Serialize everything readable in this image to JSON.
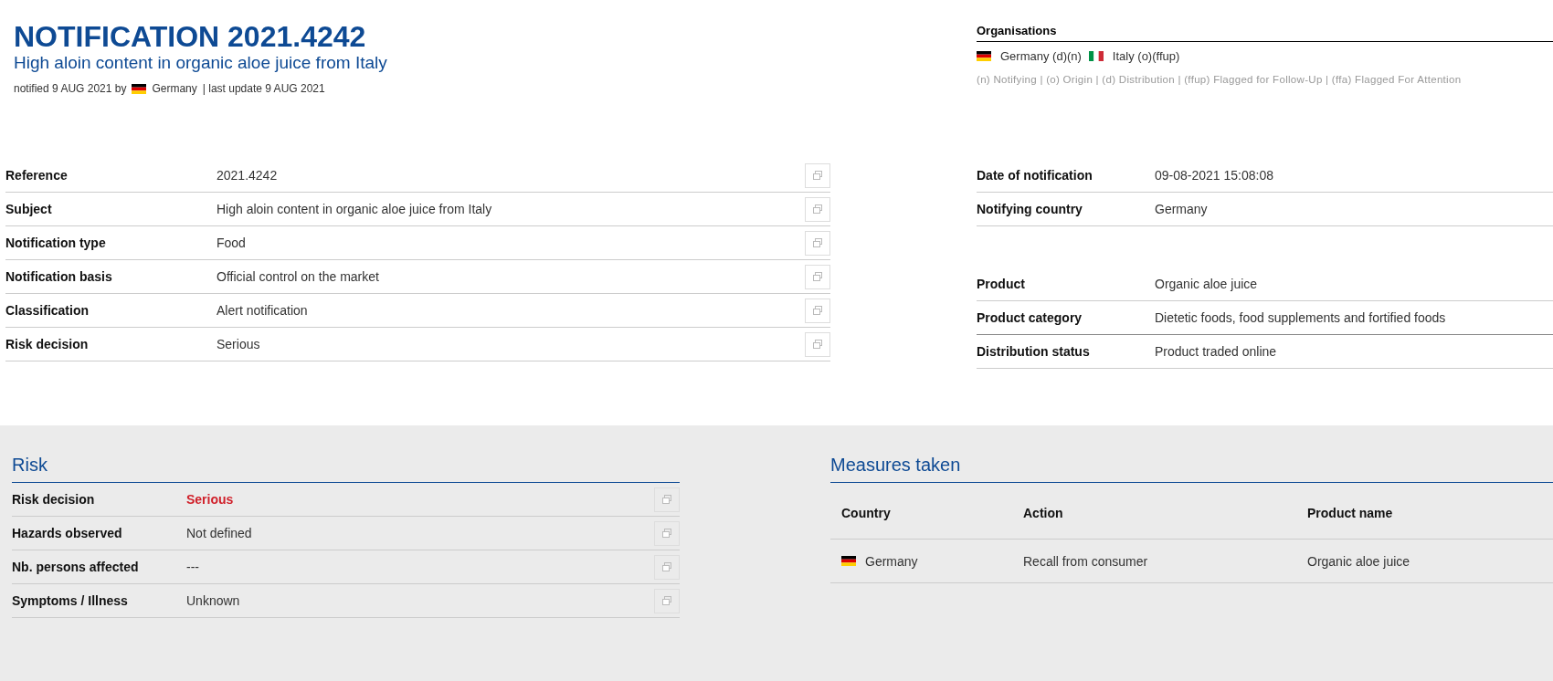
{
  "header": {
    "title": "NOTIFICATION 2021.4242",
    "subtitle": "High aloin content in organic aloe juice from Italy",
    "notified": "notified 9 AUG 2021 by",
    "notified_by": {
      "kind": "de",
      "country": "Germany"
    },
    "last_update": "| last update 9 AUG 2021"
  },
  "organisations": {
    "title": "Organisations",
    "items": [
      {
        "kind": "de",
        "label": "Germany (d)(n)"
      },
      {
        "kind": "it",
        "label": "Italy (o)(ffup)"
      }
    ],
    "legend": "(n) Notifying | (o) Origin | (d) Distribution | (ffup) Flagged for Follow-Up | (ffa) Flagged For Attention"
  },
  "details": [
    {
      "label": "Reference",
      "value": "2021.4242"
    },
    {
      "label": "Subject",
      "value": "High aloin content in organic aloe juice from Italy"
    },
    {
      "label": "Notification type",
      "value": "Food"
    },
    {
      "label": "Notification basis",
      "value": "Official control on the market"
    },
    {
      "label": "Classification",
      "value": "Alert notification"
    },
    {
      "label": "Risk decision",
      "value": "Serious"
    }
  ],
  "notification_info": [
    {
      "label": "Date of notification",
      "value": "09-08-2021 15:08:08"
    },
    {
      "label": "Notifying country",
      "value": "Germany"
    }
  ],
  "product_info": [
    {
      "label": "Product",
      "value": "Organic aloe juice"
    },
    {
      "label": "Product category",
      "value": "Dietetic foods, food supplements and fortified foods"
    },
    {
      "label": "Distribution status",
      "value": "Product traded online"
    }
  ],
  "risk": {
    "title": "Risk",
    "rows": [
      {
        "label": "Risk decision",
        "value": "Serious",
        "alert": true
      },
      {
        "label": "Hazards observed",
        "value": "Not defined",
        "alert": false
      },
      {
        "label": "Nb. persons affected",
        "value": "---",
        "alert": false
      },
      {
        "label": "Symptoms / Illness",
        "value": "Unknown",
        "alert": false
      }
    ]
  },
  "measures": {
    "title": "Measures taken",
    "columns": [
      "Country",
      "Action",
      "Product name"
    ],
    "rows": [
      {
        "kind": "de",
        "country": "Germany",
        "action": "Recall from consumer",
        "product": "Organic aloe juice"
      }
    ]
  }
}
